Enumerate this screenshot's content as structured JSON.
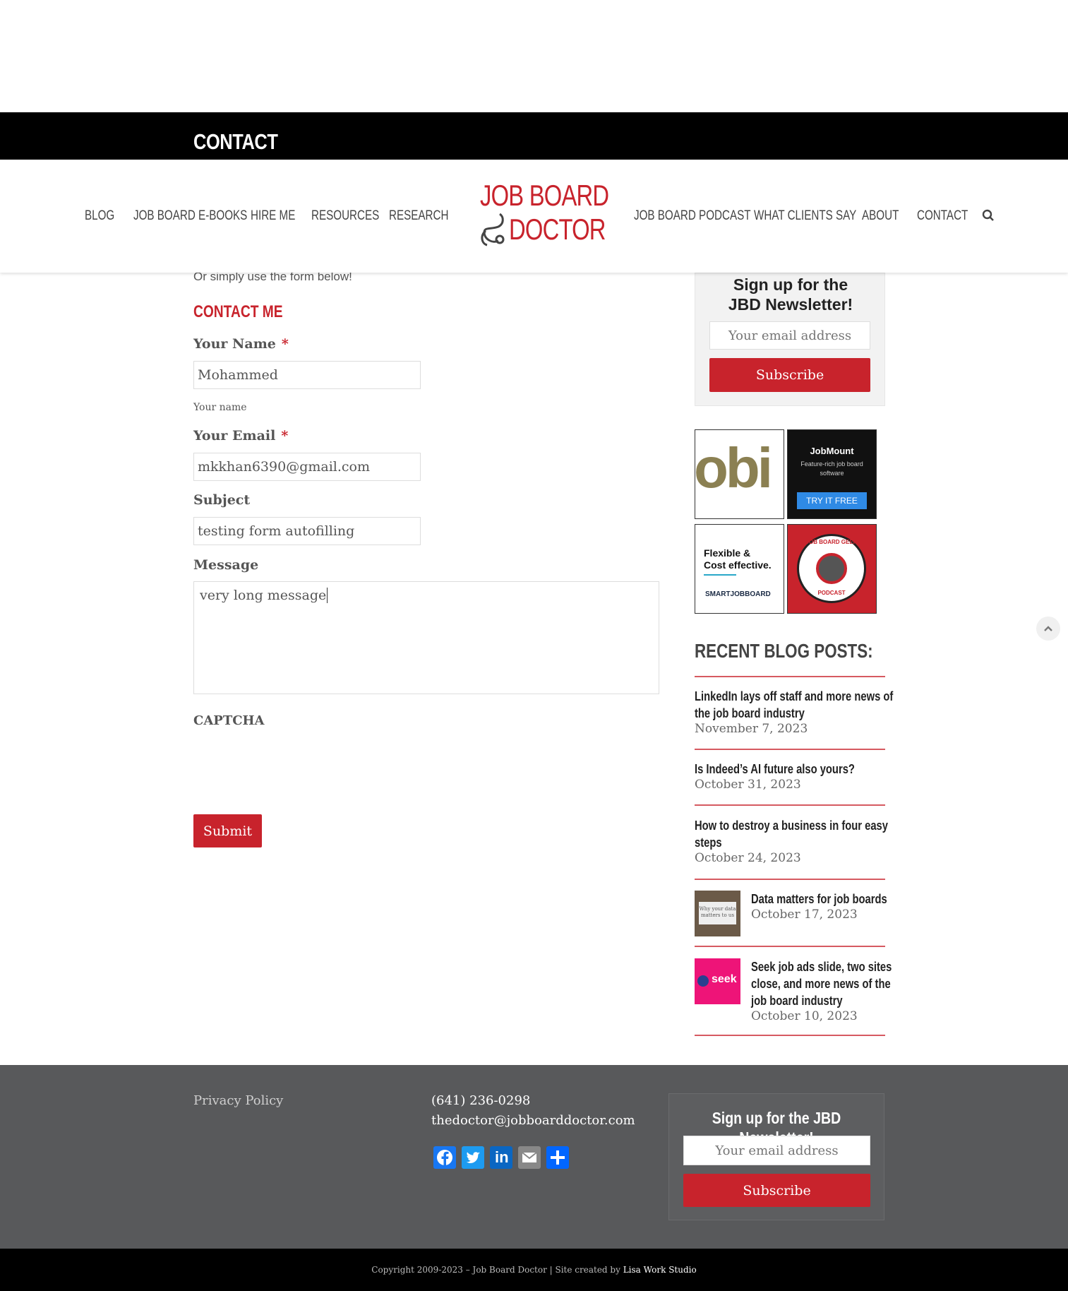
{
  "page_title": "CONTACT",
  "nav_left": [
    "BLOG",
    "JOB BOARD E-BOOKS",
    "HIRE ME",
    "RESOURCES",
    "RESEARCH"
  ],
  "nav_right": [
    "JOB BOARD PODCAST",
    "WHAT CLIENTS SAY",
    "ABOUT",
    "CONTACT"
  ],
  "logo": {
    "line1": "JOB BOARD",
    "line2": "DOCTOR"
  },
  "icons": {
    "search": "search-icon",
    "scroll_top": "chevron-up-icon"
  },
  "colors": {
    "brand_red": "#c8232c",
    "footer_bg": "#58595b"
  },
  "intro_text": "Or simply use the form below!",
  "form": {
    "heading": "CONTACT ME",
    "name_label": "Your Name",
    "name_value": "Mohammed",
    "name_hint": "Your name",
    "email_label": "Your Email",
    "email_value": "mkkhan6390@gmail.com",
    "subject_label": "Subject",
    "subject_value": "testing form autofilling",
    "message_label": "Message",
    "message_value": "very long message",
    "captcha_label": "CAPTCHA",
    "submit_label": "Submit",
    "required_mark": "*"
  },
  "sidebar": {
    "newsletter_title": "Sign up for the JBD Newsletter!",
    "email_placeholder": "Your email address",
    "subscribe_label": "Subscribe",
    "ads": {
      "obi": "obi",
      "jobmount_brand": "JobMount",
      "jobmount_tag": "Feature-rich job board software",
      "jobmount_cta": "TRY IT FREE",
      "smart_line1": "Flexible &",
      "smart_line2": "Cost effective.",
      "smart_brand": "SMARTJOBBOARD",
      "geek_top": "JOB BOARD GEEK",
      "geek_bottom": "PODCAST"
    },
    "recent_heading": "RECENT BLOG POSTS:",
    "posts": [
      {
        "title_1": "LinkedIn lays off staff and more news of",
        "title_2": "the job board industry",
        "date": "November 7, 2023"
      },
      {
        "title_1": "Is Indeed’s AI future also yours?",
        "date": "October 31, 2023"
      },
      {
        "title_1": "How to destroy a business in four easy",
        "title_2": "steps",
        "date": "October 24, 2023"
      },
      {
        "title_1": "Data matters for job boards",
        "date": "October 17, 2023",
        "thumb_text": "Why your data matters to us"
      },
      {
        "title_1": "Seek job ads slide, two sites",
        "title_2": "close, and more news of the",
        "title_3": "job board industry",
        "date": "October 10, 2023",
        "thumb_text": "seek"
      }
    ]
  },
  "footer": {
    "privacy": "Privacy Policy",
    "phone": "(641) 236-0298",
    "email": "thedoctor@jobboarddoctor.com",
    "share_icons": [
      "facebook-icon",
      "twitter-icon",
      "linkedin-icon",
      "email-icon",
      "share-plus-icon"
    ],
    "newsletter_title": "Sign up for the JBD Newsletter!",
    "email_placeholder": "Your email address",
    "subscribe_label": "Subscribe",
    "copyright": "Copyright 2009-2023 – Job Board Doctor | Site created by ",
    "credit": "Lisa Work Studio"
  }
}
